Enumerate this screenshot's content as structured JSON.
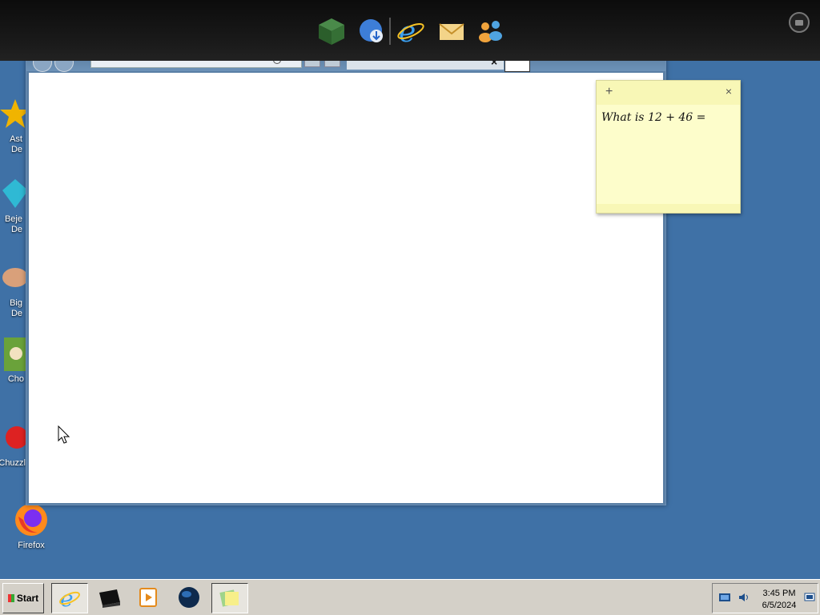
{
  "desktop": {
    "icons": [
      {
        "label": "Ast\nDe",
        "icon": "star-game-icon"
      },
      {
        "label": "Beje\nDe",
        "icon": "gem-icon"
      },
      {
        "label": "Big \nDe",
        "icon": "fish-icon"
      },
      {
        "label": "Cho",
        "icon": "game-box-icon"
      },
      {
        "label": "Chuzzl",
        "icon": "chuzzle-icon"
      },
      {
        "label": "Firefox",
        "icon": "firefox-icon"
      }
    ]
  },
  "dock": {
    "items": [
      "spreadsheet-cube-icon",
      "globe-download-icon",
      "internet-explorer-icon",
      "mail-icon",
      "people-icon"
    ]
  },
  "sticky_note": {
    "text": "What is 12 + 46 =",
    "add_symbol": "+",
    "close_symbol": "×"
  },
  "taskbar": {
    "start_label": "Start",
    "items": [
      "internet-explorer-icon",
      "black-box-icon",
      "media-player-icon",
      "globe-icon",
      "sticky-notes-icon"
    ],
    "active_item": "sticky-notes-icon",
    "clock": {
      "time": "3:45 PM",
      "date": "6/5/2024"
    }
  },
  "browser": {
    "tab_close_symbol": "×"
  }
}
